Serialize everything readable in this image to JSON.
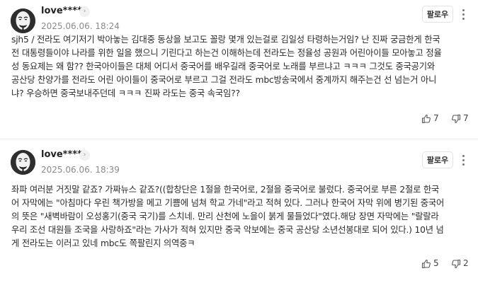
{
  "comments": [
    {
      "username": "love****",
      "timestamp": "2025.06.06. 18:24",
      "follow_label": "팔로우",
      "text": "sjh5 / 전라도 여기저기 박아놓는 김대중 동상을 보고도 꼴랑 몇개 있는걸로 김일성 타령하는거임? 난 진짜 궁금한게 한국\n전 대통령들이야 나라를 위한 일을 했으니 기린다고 하는건 이해하는데 전라도는 정율성 공원과 어린아이들 모아놓고 정율\n성 동요제는 왜 함?? 한국아이들은 대체 어디서 중국어를 배우길래 중국어로 노래를 부르냐고 ㅋㅋㅋ 그것도 중국공기와\n공산당 찬양가를 전라도 어린 아이들이 중국어로 부르고 그걸 전라도 mbc방송국에서 중계까지 해주는건 선 넘는거 아니\n냐? 우승하면 중국보내주던데 ㅋㅋㅋ 진짜 라도는 중국 속국임??",
      "likes": "7",
      "dislikes": "7"
    },
    {
      "username": "love****",
      "timestamp": "2025.06.06. 18:39",
      "follow_label": "팔로우",
      "text": "좌파 여러분 거짓말 같죠? 가짜뉴스 같죠?((합창단은 1절을 한국어로, 2절을 중국어로 불렀다. 중국어로 부른 2절로 한국\n어 자막에는 \"아침마다 우린 책가방을 메고 기쁨에 넘쳐 학교 가네\"라고 적혀 있다. 그러나 한국어 자막 위에 병기된 중국어\n의 뜻은 \"새벽바람이 오성홍기(중국 국기)를 스치네. 만리 산천에 노을이 붉게 물들었다\"였다.해당 장면 자막에는 \"랄랄라\n우리 조선 대원들 조국을 사랑하죠\"라는 가사가 적혀 있지만 중국 악보에는 중국 공산당 소년선봉대로 되어 있다.) 10년 넘\n게 전라도는 이러고 있네 mbc도 쪽팔린지 의역중ㅋ",
      "likes": "5",
      "dislikes": "2"
    }
  ]
}
